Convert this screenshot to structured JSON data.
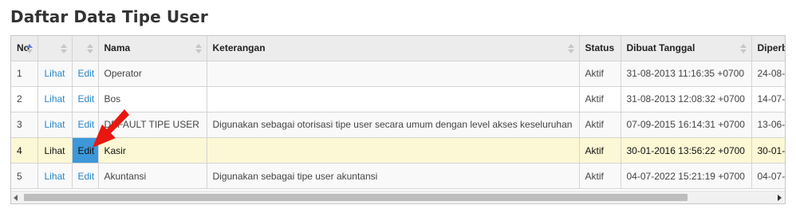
{
  "page": {
    "title": "Daftar Data Tipe User"
  },
  "table": {
    "columns": {
      "no": "No",
      "view": "",
      "edit": "",
      "nama": "Nama",
      "keterangan": "Keterangan",
      "status": "Status",
      "dibuat": "Dibuat Tanggal",
      "diperbarui": "Diperb"
    },
    "rows": [
      {
        "no": "1",
        "view": "Lihat",
        "edit": "Edit",
        "nama": "Operator",
        "keterangan": "",
        "status": "Aktif",
        "dibuat": "31-08-2013 11:16:35 +0700",
        "diperbarui": "24-08-"
      },
      {
        "no": "2",
        "view": "Lihat",
        "edit": "Edit",
        "nama": "Bos",
        "keterangan": "",
        "status": "Aktif",
        "dibuat": "31-08-2013 12:08:32 +0700",
        "diperbarui": "14-07-"
      },
      {
        "no": "3",
        "view": "Lihat",
        "edit": "Edit",
        "nama": "DEFAULT TIPE USER",
        "keterangan": "Digunakan sebagai otorisasi tipe user secara umum dengan level akses keseluruhan",
        "status": "Aktif",
        "dibuat": "07-09-2015 16:14:31 +0700",
        "diperbarui": "13-06-"
      },
      {
        "no": "4",
        "view": "Lihat",
        "edit": "Edit",
        "nama": "Kasir",
        "keterangan": "",
        "status": "Aktif",
        "dibuat": "30-01-2016 13:56:22 +0700",
        "diperbarui": "30-01-"
      },
      {
        "no": "5",
        "view": "Lihat",
        "edit": "Edit",
        "nama": "Akuntansi",
        "keterangan": "Digunakan sebagai tipe user akuntansi",
        "status": "Aktif",
        "dibuat": "04-07-2022 15:21:19 +0700",
        "diperbarui": "04-07-"
      }
    ],
    "selected_row": 4
  },
  "icons": {
    "sort": "sort-arrows-icon",
    "annotation": "red-arrow-icon",
    "scroll_left": "scroll-left-arrow-icon",
    "scroll_right": "scroll-right-arrow-icon"
  },
  "colors": {
    "link": "#2a86c8",
    "edit_active": "#3d98d8",
    "selected_row": "#fcf8d5",
    "annotation_arrow": "#e8170f"
  }
}
